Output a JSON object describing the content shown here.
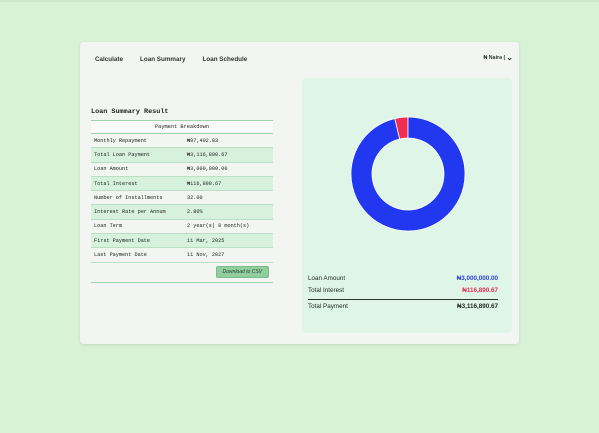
{
  "nav": {
    "items": [
      "Calculate",
      "Loan Summary",
      "Loan Schedule"
    ],
    "currency": "₦ Naira ("
  },
  "summary": {
    "title": "Loan Summary Result",
    "table_header": "Payment Breakdown",
    "rows": [
      {
        "label": "Monthly Repayment",
        "value": "₦97,402.83"
      },
      {
        "label": "Total Loan Payment",
        "value": "₦3,116,890.67"
      },
      {
        "label": "Loan Amount",
        "value": "₦3,000,000.00"
      },
      {
        "label": "Total Interest",
        "value": "₦116,890.67"
      },
      {
        "label": "Number of Installments",
        "value": "32.00"
      },
      {
        "label": "Interest Rate per Annum",
        "value": "2.80%"
      },
      {
        "label": "Loan Term",
        "value": "2 year(s) 8 month(s)"
      },
      {
        "label": "First Payment Date",
        "value": "11 Mar, 2025"
      },
      {
        "label": "Last Payment Date",
        "value": "11 Nov, 2027"
      }
    ],
    "download_label": "Download to CSV"
  },
  "totals": {
    "loan_amount_label": "Loan Amount",
    "loan_amount_value": "₦3,000,000.00",
    "interest_label": "Total Interest",
    "interest_value": "₦116,890.67",
    "payment_label": "Total Payment",
    "payment_value": "₦3,116,890.67"
  },
  "chart_data": {
    "type": "pie",
    "categories": [],
    "values": [
      3000000.0,
      116890.67
    ],
    "colors": [
      "#2237f0",
      "#ef2d55"
    ]
  },
  "colors": {
    "principal": "#2237f0",
    "interest": "#ef2d55",
    "principal_text": "#2a3fd6",
    "interest_text": "#e0304f"
  }
}
